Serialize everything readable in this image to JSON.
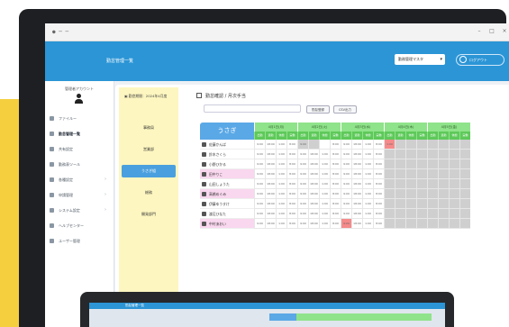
{
  "window": {
    "controls": [
      "–",
      "□",
      "×"
    ]
  },
  "app": {
    "title": "勤怠管理一覧",
    "select_value": "勤務管理マスタ",
    "logout_label": "ログアウト"
  },
  "user": {
    "name": "管理者アカウント"
  },
  "nav": [
    {
      "label": "ファイルー",
      "active": false,
      "chevron": false
    },
    {
      "label": "勤怠管理一覧",
      "active": true,
      "chevron": false
    },
    {
      "label": "共有設定",
      "active": false,
      "chevron": false
    },
    {
      "label": "勤務表ツール",
      "active": false,
      "chevron": false
    },
    {
      "label": "各種設定",
      "active": false,
      "chevron": true
    },
    {
      "label": "申請管理",
      "active": false,
      "chevron": true
    },
    {
      "label": "システム設定",
      "active": false,
      "chevron": true
    },
    {
      "label": "ヘルプセンター",
      "active": false,
      "chevron": false
    },
    {
      "label": "ユーザー管理",
      "active": false,
      "chevron": false
    }
  ],
  "left_panel": {
    "header": "勤怠期間：2024年4月度",
    "items": [
      "事務局",
      "営業部",
      "うさぎ組",
      "総務",
      "開発部門"
    ],
    "active_index": 2
  },
  "toolbar": {
    "title": "勤怠確認 / 月次手当",
    "btn1": "勤怠登録",
    "btn2": "CSV出力"
  },
  "grid": {
    "group_label": "うさぎ",
    "days": [
      "4月1日(月)",
      "4月2日(火)",
      "4月3日(水)",
      "4月4日(木)",
      "4月5日(金)"
    ],
    "sub_columns": [
      "出勤",
      "退勤",
      "休憩",
      "実働"
    ],
    "rows": [
      {
        "name": "佐藤かんぱ",
        "highlight": false,
        "cells": [
          "9:00",
          "18:00",
          "1:00",
          "8:00",
          "9:00",
          "",
          "",
          "8:00",
          "9:00",
          "18:00",
          "1:00",
          "8:00",
          "1:00",
          "",
          "",
          "",
          "",
          "",
          "",
          ""
        ]
      },
      {
        "name": "鈴木さくら",
        "highlight": false,
        "cells": [
          "9:00",
          "18:00",
          "1:00",
          "8:00",
          "9:00",
          "18:00",
          "1:00",
          "8:00",
          "9:00",
          "18:00",
          "1:00",
          "8:00",
          "",
          "",
          "",
          "",
          "",
          "",
          "",
          ""
        ]
      },
      {
        "name": "小野ひかる",
        "highlight": false,
        "cells": [
          "9:00",
          "18:00",
          "1:00",
          "8:00",
          "9:00",
          "18:00",
          "1:00",
          "8:00",
          "9:00",
          "18:00",
          "1:00",
          "8:00",
          "",
          "",
          "",
          "",
          "",
          "",
          "",
          ""
        ]
      },
      {
        "name": "田中りこ",
        "highlight": true,
        "cells": [
          "9:00",
          "18:00",
          "1:00",
          "8:00",
          "9:00",
          "18:00",
          "1:00",
          "8:00",
          "9:00",
          "18:00",
          "1:00",
          "8:00",
          "",
          "",
          "",
          "",
          "",
          "",
          "",
          ""
        ]
      },
      {
        "name": "山田しょうた",
        "highlight": false,
        "cells": [
          "9:00",
          "18:00",
          "1:00",
          "8:00",
          "9:00",
          "18:00",
          "1:00",
          "8:00",
          "9:00",
          "18:00",
          "1:00",
          "8:00",
          "",
          "",
          "",
          "",
          "",
          "",
          "",
          ""
        ]
      },
      {
        "name": "高橋めぐみ",
        "highlight": true,
        "cells": [
          "9:00",
          "18:00",
          "1:00",
          "8:00",
          "9:00",
          "18:00",
          "1:00",
          "8:00",
          "9:00",
          "18:00",
          "1:00",
          "8:00",
          "",
          "",
          "",
          "",
          "",
          "",
          "",
          ""
        ]
      },
      {
        "name": "伊藤ゆうすけ",
        "highlight": false,
        "cells": [
          "9:00",
          "18:00",
          "1:00",
          "8:00",
          "9:00",
          "18:00",
          "1:00",
          "8:00",
          "9:00",
          "18:00",
          "1:00",
          "8:00",
          "",
          "",
          "",
          "",
          "",
          "",
          "",
          ""
        ]
      },
      {
        "name": "渡辺ひなた",
        "highlight": false,
        "cells": [
          "9:00",
          "18:00",
          "1:00",
          "8:00",
          "9:00",
          "18:00",
          "1:00",
          "8:00",
          "9:00",
          "18:00",
          "1:00",
          "8:00",
          "",
          "",
          "",
          "",
          "",
          "",
          "",
          ""
        ]
      },
      {
        "name": "中村あおい",
        "highlight": true,
        "cells": [
          "9:00",
          "18:00",
          "1:00",
          "8:00",
          "9:00",
          "18:00",
          "1:00",
          "8:00",
          "9:00",
          "18:00",
          "1:00",
          "8:00",
          "",
          "",
          "",
          "",
          "",
          "",
          "",
          ""
        ]
      }
    ],
    "gray_cells": [
      [
        0,
        4
      ],
      [
        0,
        5
      ],
      [
        0,
        12
      ],
      [
        0,
        13
      ],
      [
        0,
        14
      ],
      [
        0,
        15
      ],
      [
        0,
        16
      ],
      [
        0,
        17
      ],
      [
        0,
        18
      ],
      [
        0,
        19
      ],
      [
        1,
        12
      ],
      [
        1,
        13
      ],
      [
        1,
        14
      ],
      [
        1,
        15
      ],
      [
        1,
        16
      ],
      [
        1,
        17
      ],
      [
        1,
        18
      ],
      [
        1,
        19
      ],
      [
        2,
        12
      ],
      [
        2,
        13
      ],
      [
        2,
        14
      ],
      [
        2,
        15
      ],
      [
        2,
        16
      ],
      [
        2,
        17
      ],
      [
        2,
        18
      ],
      [
        2,
        19
      ],
      [
        3,
        12
      ],
      [
        3,
        13
      ],
      [
        3,
        14
      ],
      [
        3,
        15
      ],
      [
        3,
        16
      ],
      [
        3,
        17
      ],
      [
        3,
        18
      ],
      [
        3,
        19
      ],
      [
        4,
        12
      ],
      [
        4,
        13
      ],
      [
        4,
        14
      ],
      [
        4,
        15
      ],
      [
        4,
        16
      ],
      [
        4,
        17
      ],
      [
        4,
        18
      ],
      [
        4,
        19
      ],
      [
        5,
        12
      ],
      [
        5,
        13
      ],
      [
        5,
        14
      ],
      [
        5,
        15
      ],
      [
        5,
        16
      ],
      [
        5,
        17
      ],
      [
        5,
        18
      ],
      [
        5,
        19
      ],
      [
        6,
        12
      ],
      [
        6,
        13
      ],
      [
        6,
        14
      ],
      [
        6,
        15
      ],
      [
        6,
        16
      ],
      [
        6,
        17
      ],
      [
        6,
        18
      ],
      [
        6,
        19
      ],
      [
        7,
        12
      ],
      [
        7,
        13
      ],
      [
        7,
        14
      ],
      [
        7,
        15
      ],
      [
        7,
        16
      ],
      [
        7,
        17
      ],
      [
        7,
        18
      ],
      [
        7,
        19
      ],
      [
        8,
        12
      ],
      [
        8,
        13
      ],
      [
        8,
        14
      ],
      [
        8,
        15
      ],
      [
        8,
        16
      ],
      [
        8,
        17
      ],
      [
        8,
        18
      ],
      [
        8,
        19
      ]
    ],
    "red_cells": [
      [
        0,
        12
      ],
      [
        8,
        8
      ]
    ]
  },
  "laptop": {
    "title": "勤怠管理一覧"
  },
  "colors": {
    "app_bar": "#2b95d6",
    "day_header": "#8fe38a",
    "sub_header": "#5ec95a",
    "name_header": "#5aa8e6",
    "left_panel": "#fdf6c0",
    "highlight_row": "#f9d7ee",
    "red_cell": "#f58a8a",
    "gray_cell": "#cfcfcf",
    "accent_band": "#f5cf3e"
  }
}
